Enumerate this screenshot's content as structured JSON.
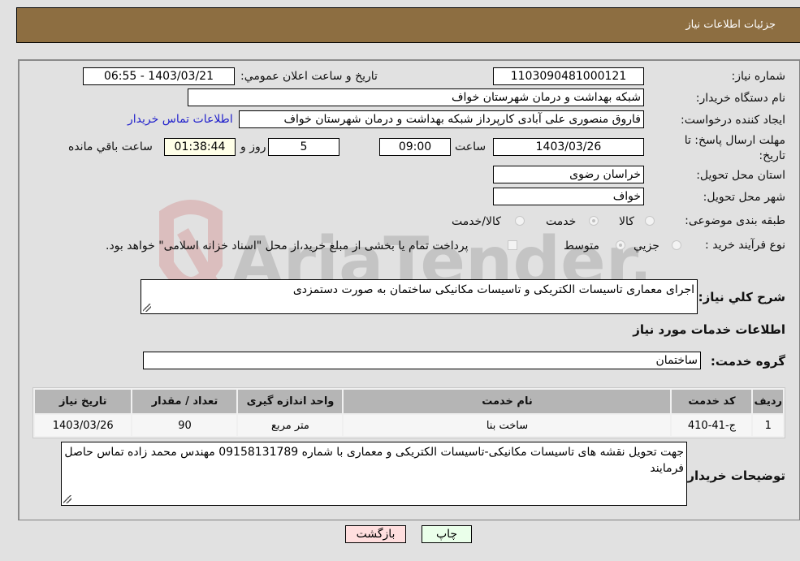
{
  "header": {
    "title": "جزئیات اطلاعات نیاز"
  },
  "fields": {
    "need_number": {
      "label": "شماره نیاز:",
      "value": "1103090481000121"
    },
    "announce_datetime": {
      "label": "تاریخ و ساعت اعلان عمومي:",
      "value": "1403/03/21 - 06:55"
    },
    "buyer_org": {
      "label": "نام دستگاه خریدار:",
      "value": "شبکه بهداشت و درمان شهرستان خواف"
    },
    "requester": {
      "label": "ایجاد کننده درخواست:",
      "value": "فاروق منصوری علی آبادی کارپرداز شبکه بهداشت و درمان شهرستان خواف",
      "link": "اطلاعات تماس خریدار"
    },
    "deadline": {
      "label": "مهلت ارسال پاسخ: تا تاریخ:",
      "date": "1403/03/26",
      "time_label": "ساعت",
      "time": "09:00",
      "days": "5",
      "days_label": "روز و",
      "remaining": "01:38:44",
      "remaining_label": "ساعت باقي مانده"
    },
    "province": {
      "label": "استان محل تحویل:",
      "value": "خراسان رضوی"
    },
    "city": {
      "label": "شهر محل تحویل:",
      "value": "خواف"
    },
    "category": {
      "label": "طبقه بندی موضوعی:",
      "options": [
        {
          "label": "کالا",
          "selected": false
        },
        {
          "label": "خدمت",
          "selected": true
        },
        {
          "label": "کالا/خدمت",
          "selected": false
        }
      ]
    },
    "purchase_type": {
      "label": "نوع فرآیند خرید :",
      "options": [
        {
          "label": "جزیي",
          "selected": false
        },
        {
          "label": "متوسط",
          "selected": true
        }
      ],
      "treasury_note": "پرداخت تمام یا بخشی از مبلغ خرید،از محل \"اسناد خزانه اسلامی\" خواهد بود.",
      "treasury_checked": false
    },
    "general_description": {
      "label": "شرح كلي نياز:",
      "value": "اجرای معماری تاسیسات الکتریکی و تاسیسات مکانیکی ساختمان  به صورت دستمزدی"
    }
  },
  "services_section": {
    "title": "اطلاعات خدمات مورد نیاز",
    "group_label": "گروه خدمت:",
    "group_value": "ساختمان",
    "table": {
      "headers": [
        "ردیف",
        "کد خدمت",
        "نام خدمت",
        "واحد اندازه گیری",
        "تعداد / مقدار",
        "تاریخ نیاز"
      ],
      "rows": [
        [
          "1",
          "ج-41-410",
          "ساخت بنا",
          "متر مربع",
          "90",
          "1403/03/26"
        ]
      ]
    }
  },
  "buyer_notes": {
    "label": "توضیحات خریدار:",
    "value": "جهت تحویل نقشه های تاسیسات  مکانیکی-تاسیسات الکتریکی و معماری با شماره 09158131789 مهندس محمد زاده تماس حاصل فرمایند"
  },
  "buttons": {
    "print": "چاپ",
    "back": "بازگشت"
  },
  "colors": {
    "header_bg": "#8d6e41",
    "print_bg": "#eaffea",
    "back_bg": "#ffdede",
    "link": "#2222cc"
  },
  "watermark": {
    "text": "AriaTender.net"
  }
}
